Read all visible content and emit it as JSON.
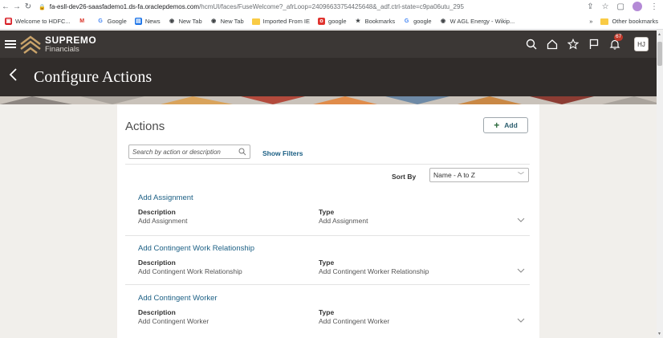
{
  "browser": {
    "url_host": "fa-esll-dev26-saasfademo1.ds-fa.oraclepdemos.com",
    "url_path": "/hcmUI/faces/FuseWelcome?_afrLoop=24096633754425648&_adf.ctrl-state=c9pa06utu_295",
    "bookmarks": [
      {
        "label": "Welcome to HDFC...",
        "icon": "hdfc-icon",
        "color": "#d71920"
      },
      {
        "label": "",
        "icon": "gmail-icon",
        "color": "#d93025"
      },
      {
        "label": "Google",
        "icon": "google-icon",
        "color": "#4285f4"
      },
      {
        "label": "News",
        "icon": "news-icon",
        "color": "#1a73e8"
      },
      {
        "label": "New Tab",
        "icon": "chrome-icon",
        "color": "#3c4043"
      },
      {
        "label": "New Tab",
        "icon": "chrome-icon",
        "color": "#3c4043"
      },
      {
        "label": "Imported From IE",
        "icon": "folder-icon",
        "color": "#f9cb45"
      },
      {
        "label": "google",
        "icon": "opera-icon",
        "color": "#e0332f"
      },
      {
        "label": "Bookmarks",
        "icon": "star-icon",
        "color": "#3c4043"
      },
      {
        "label": "google",
        "icon": "google-icon",
        "color": "#4285f4"
      },
      {
        "label": "W  AGL Energy - Wikip...",
        "icon": "chrome-icon",
        "color": "#3c4043"
      }
    ],
    "more_label": "»",
    "other_bookmarks": "Other bookmarks"
  },
  "header": {
    "brand_name": "SUPREMO",
    "brand_sub": "Financials",
    "notification_count": "67",
    "avatar_initials": "HJ",
    "page_title": "Configure Actions"
  },
  "card": {
    "title": "Actions",
    "add_label": "Add",
    "search_placeholder": "Search by action or description",
    "show_filters": "Show Filters",
    "sort_by_label": "Sort By",
    "sort_by_value": "Name - A to Z",
    "description_label": "Description",
    "type_label": "Type",
    "rows": [
      {
        "title": "Add Assignment",
        "description": "Add Assignment",
        "type": "Add Assignment"
      },
      {
        "title": "Add Contingent Work Relationship",
        "description": "Add Contingent Work Relationship",
        "type": "Add Contingent Worker Relationship"
      },
      {
        "title": "Add Contingent Worker",
        "description": "Add Contingent Worker",
        "type": "Add Contingent Worker"
      }
    ]
  },
  "colors": {
    "header_bg": "#3b3735",
    "title_bar_bg": "#302c2a",
    "link": "#1b5f84",
    "add_plus": "#2c6a3d",
    "badge": "#c0392b"
  }
}
